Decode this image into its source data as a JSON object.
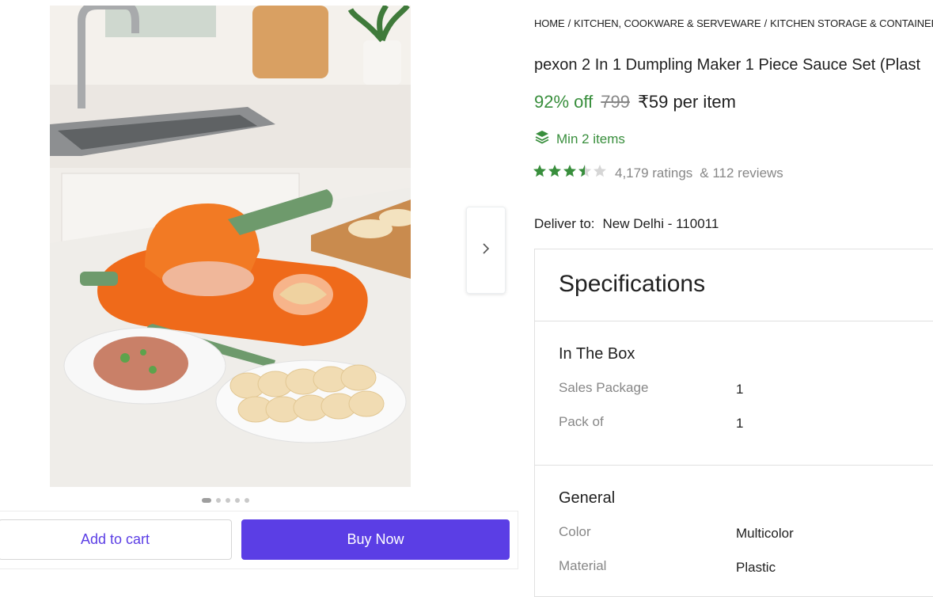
{
  "breadcrumb": [
    "HOME",
    "KITCHEN, COOKWARE & SERVEWARE",
    "KITCHEN STORAGE & CONTAINERS",
    ""
  ],
  "product": {
    "title": "pexon 2 In 1 Dumpling Maker 1 Piece Sauce Set (Plast",
    "discount": "92% off",
    "mrp": "799",
    "price": "₹59 per item",
    "min_items": "Min 2 items",
    "rating_stars": 3.5,
    "ratings": "4,179 ratings",
    "reviews": "& 112 reviews"
  },
  "delivery": {
    "label": "Deliver to:",
    "location": "New Delhi - 110011"
  },
  "carousel": {
    "image_count": 5,
    "active_index": 0
  },
  "actions": {
    "add_to_cart": "Add to cart",
    "buy_now": "Buy Now"
  },
  "specifications": {
    "heading": "Specifications",
    "groups": [
      {
        "title": "In The Box",
        "rows": [
          {
            "key": "Sales Package",
            "value": "1"
          },
          {
            "key": "Pack of",
            "value": "1"
          }
        ]
      },
      {
        "title": "General",
        "rows": [
          {
            "key": "Color",
            "value": "Multicolor"
          },
          {
            "key": "Material",
            "value": "Plastic"
          }
        ]
      }
    ]
  },
  "colors": {
    "accent": "#5b3ee5",
    "discount_green": "#388e3c",
    "star_green": "#388e3c"
  },
  "icons": {
    "next": "chevron-right-icon",
    "min_items": "layers-icon",
    "star": "star-icon"
  }
}
